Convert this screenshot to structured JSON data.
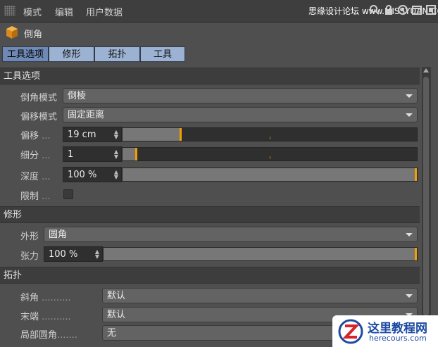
{
  "menubar": {
    "items": [
      "模式",
      "编辑",
      "用户数据"
    ],
    "watermark": "思缘设计论坛 www.MISSYUAN.COM"
  },
  "header": {
    "title": "倒角"
  },
  "tabs": [
    {
      "label": "工具选项",
      "active": true
    },
    {
      "label": "修形",
      "active": false
    },
    {
      "label": "拓扑",
      "active": false
    },
    {
      "label": "工具",
      "active": false
    }
  ],
  "tool_options": {
    "section_title": "工具选项",
    "bevel_mode_label": "倒角模式",
    "bevel_mode_value": "倒棱",
    "offset_mode_label": "偏移模式",
    "offset_mode_value": "固定距离",
    "offset_label": "偏移",
    "offset_value": "19 cm",
    "offset_level": 0.2,
    "subdivision_label": "细分",
    "subdivision_value": "1",
    "subdivision_level": 0.05,
    "depth_label": "深度",
    "depth_value": "100 %",
    "depth_level": 1.0,
    "limit_label": "限制",
    "dots": "...",
    "limit_checked": false
  },
  "shaping": {
    "section_title": "修形",
    "shape_label": "外形",
    "shape_value": "圆角",
    "tension_label": "张力",
    "tension_value": "100 %",
    "tension_level": 1.0
  },
  "topology": {
    "section_title": "拓扑",
    "mitering_label": "斜角",
    "mitering_dots": "..........",
    "mitering_value": "默认",
    "ending_label": "末端",
    "ending_dots": "..........",
    "ending_value": "默认",
    "partial_rounding_label": "局部圆角",
    "partial_rounding_dots": ".......",
    "partial_rounding_value": "无"
  },
  "logo": {
    "main": "这里教程网",
    "sub": "herecours.com"
  },
  "colors": {
    "accent": "#f0a000",
    "tab_active": "#6f89b5",
    "tab_inactive": "#9cb2d2"
  }
}
